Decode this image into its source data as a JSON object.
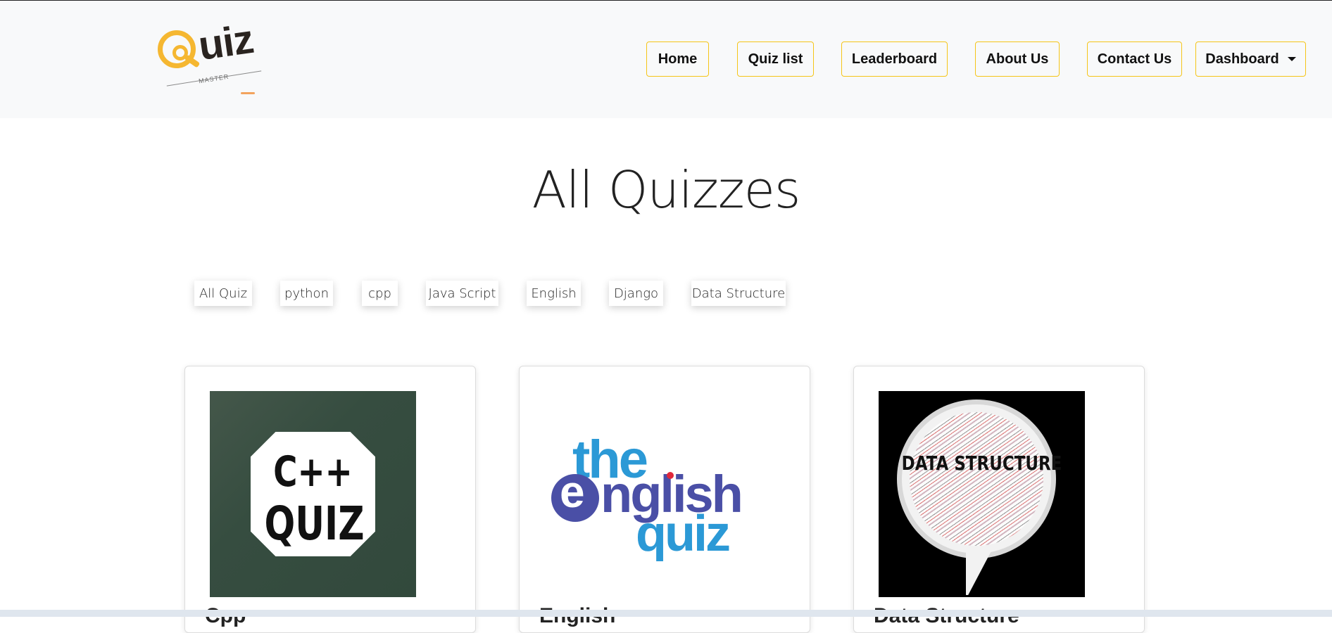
{
  "brand": {
    "logo_text": "uiz",
    "logo_subtext": "MASTER"
  },
  "nav": {
    "home": "Home",
    "quiz_list": "Quiz list",
    "leaderboard": "Leaderboard",
    "about": "About Us",
    "contact": "Contact Us",
    "dashboard": "Dashboard"
  },
  "page": {
    "title": "All Quizzes"
  },
  "filters": [
    "All Quiz",
    "python",
    "cpp",
    "Java Script",
    "English",
    "Django",
    "Data Structure"
  ],
  "cards": [
    {
      "image_text_1": "C++",
      "image_text_2": "QUIZ",
      "title": "Cpp"
    },
    {
      "image_text_1": "the",
      "image_text_2": "e",
      "image_text_3": "nglish",
      "image_text_4": "quiz",
      "title": "English"
    },
    {
      "image_text_1": "DATA STRUCTURE",
      "title": "Data Structure"
    }
  ],
  "colors": {
    "accent": "#f5c518",
    "navbar_bg": "#f8f9fa",
    "logo_yellow": "#f5b731"
  }
}
